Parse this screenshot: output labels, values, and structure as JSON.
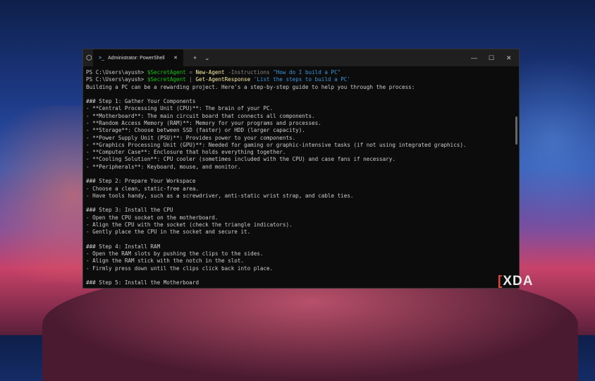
{
  "window": {
    "title": "Administrator: PowerShell",
    "new_tab": "+",
    "dropdown": "⌄",
    "minimize": "—",
    "maximize": "☐",
    "close": "✕",
    "tab_close": "✕"
  },
  "prompt": "PS C:\\Users\\ayush> ",
  "cmd1": {
    "var": "$SecretAgent",
    "op": " = ",
    "cmdlet": "New-Agent",
    "param": " -Instructions ",
    "arg": "\"How do I build a PC\""
  },
  "cmd2": {
    "var": "$SecretAgent",
    "op": " | ",
    "cmdlet": "Get-AgentResponse",
    "arg": " 'List the steps to build a PC'"
  },
  "output": [
    "Building a PC can be a rewarding project. Here's a step-by-step guide to help you through the process:",
    "",
    "### Step 1: Gather Your Components",
    "- **Central Processing Unit (CPU)**: The brain of your PC.",
    "- **Motherboard**: The main circuit board that connects all components.",
    "- **Random Access Memory (RAM)**: Memory for your programs and processes.",
    "- **Storage**: Choose between SSD (faster) or HDD (larger capacity).",
    "- **Power Supply Unit (PSU)**: Provides power to your components.",
    "- **Graphics Processing Unit (GPU)**: Needed for gaming or graphic-intensive tasks (if not using integrated graphics).",
    "- **Computer Case**: Enclosure that holds everything together.",
    "- **Cooling Solution**: CPU cooler (sometimes included with the CPU) and case fans if necessary.",
    "- **Peripherals**: Keyboard, mouse, and monitor.",
    "",
    "### Step 2: Prepare Your Workspace",
    "- Choose a clean, static-free area.",
    "- Have tools handy, such as a screwdriver, anti-static wrist strap, and cable ties.",
    "",
    "### Step 3: Install the CPU",
    "- Open the CPU socket on the motherboard.",
    "- Align the CPU with the socket (check the triangle indicators).",
    "- Gently place the CPU in the socket and secure it.",
    "",
    "### Step 4: Install RAM",
    "- Open the RAM slots by pushing the clips to the sides.",
    "- Align the RAM stick with the notch in the slot.",
    "- Firmly press down until the clips click back into place.",
    "",
    "### Step 5: Install the Motherboard"
  ],
  "watermark": {
    "bracket": "[ ]",
    "text": "XDA"
  }
}
